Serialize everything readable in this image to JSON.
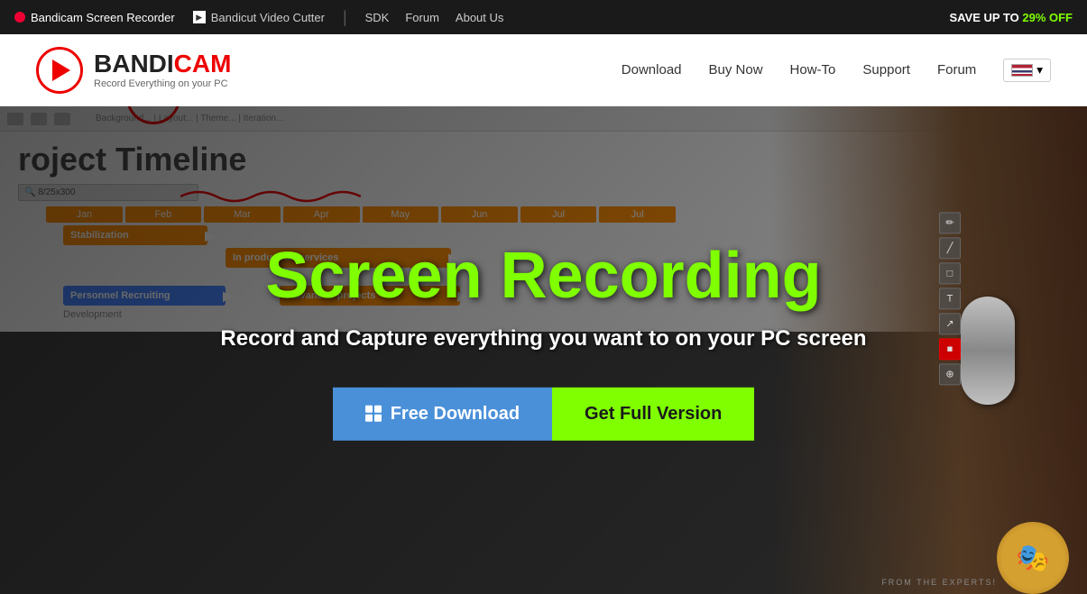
{
  "topbar": {
    "brand": "Bandicam Screen Recorder",
    "bandicut": "Bandicut Video Cutter",
    "sdk": "SDK",
    "forum_top": "Forum",
    "about_us": "About Us",
    "promo_prefix": "SAVE UP TO ",
    "promo_value": "29% OFF"
  },
  "nav": {
    "logo_name_part1": "BANDI",
    "logo_name_part2": "CAM",
    "tagline": "Record Everything on your PC",
    "download": "Download",
    "buy_now": "Buy Now",
    "how_to": "How-To",
    "support": "Support",
    "forum": "Forum"
  },
  "hero": {
    "title": "Screen Recording",
    "subtitle": "Record and Capture everything you want to on your PC screen",
    "timeline_title": "roject Timeline",
    "months": [
      "Jan",
      "Feb",
      "Mar",
      "Apr",
      "May",
      "Jun",
      "Jul",
      "Jul"
    ],
    "bar1": "Stabilization",
    "bar2": "Personnel Recruiting",
    "bar3": "Advanced projects",
    "bar4": "Development"
  },
  "cta": {
    "free_download": "Free Download",
    "get_full_version": "Get Full Version"
  },
  "footer_char": {
    "text": "FROM THE EXPERTS!"
  }
}
